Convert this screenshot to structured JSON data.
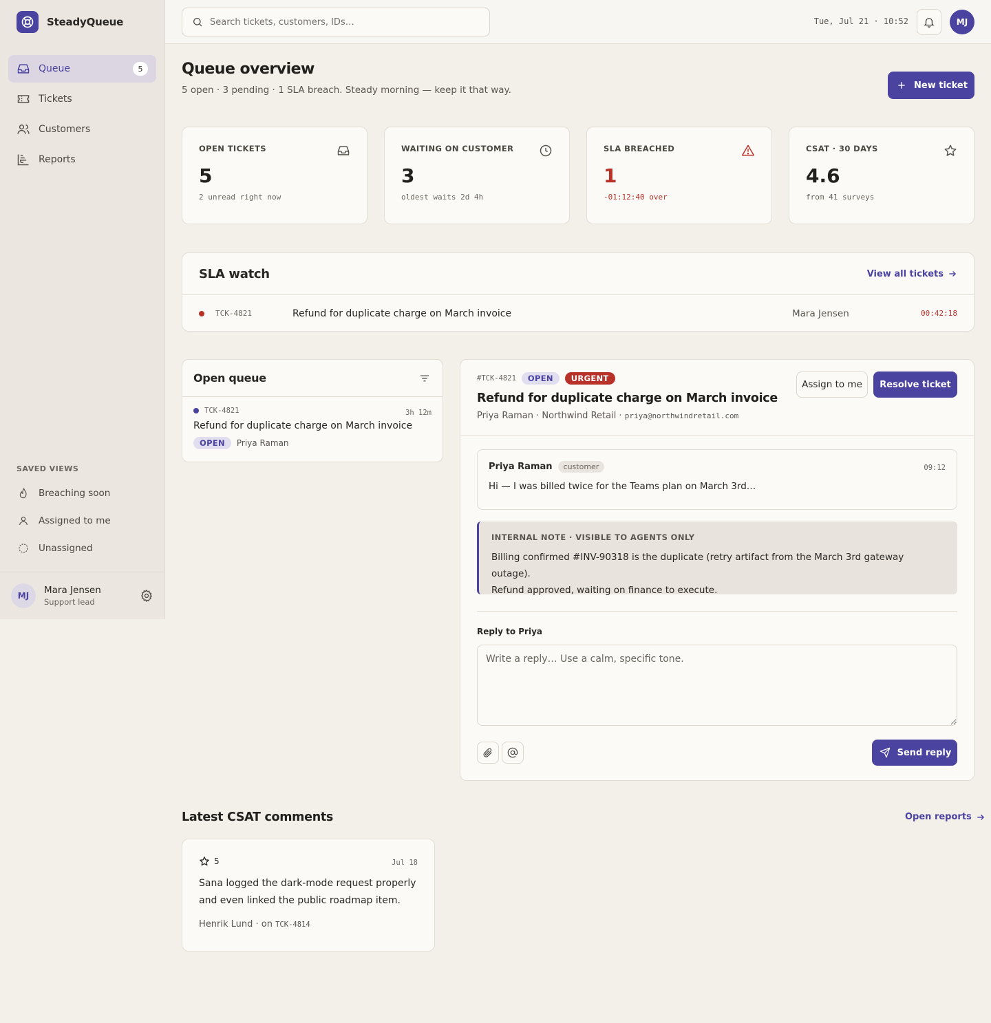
{
  "brand": {
    "name": "SteadyQueue"
  },
  "nav": [
    {
      "label": "Queue",
      "badge": "5",
      "icon": "inbox-icon"
    },
    {
      "label": "Tickets",
      "icon": "ticket-icon"
    },
    {
      "label": "Customers",
      "icon": "users-icon"
    },
    {
      "label": "Reports",
      "icon": "bar-chart-icon"
    }
  ],
  "saved_views": {
    "title": "SAVED VIEWS",
    "items": [
      {
        "label": "Breaching soon",
        "icon": "flame-icon"
      },
      {
        "label": "Assigned to me",
        "icon": "user-icon"
      },
      {
        "label": "Unassigned",
        "icon": "dashed-circle-icon"
      }
    ]
  },
  "user": {
    "initials": "MJ",
    "name": "Mara Jensen",
    "role": "Support lead"
  },
  "topbar": {
    "search_placeholder": "Search tickets, customers, IDs…",
    "datetime": "Tue, Jul 21 · 10:52",
    "avatar": "MJ"
  },
  "header": {
    "title": "Queue overview",
    "subtitle": "5 open · 3 pending · 1 SLA breach. Steady morning — keep it that way.",
    "new_ticket": "New ticket"
  },
  "stats": [
    {
      "label": "OPEN TICKETS",
      "value": "5",
      "note": "2 unread right now",
      "icon": "inbox-icon"
    },
    {
      "label": "WAITING ON CUSTOMER",
      "value": "3",
      "note": "oldest waits 2d 4h",
      "icon": "clock-icon"
    },
    {
      "label": "SLA BREACHED",
      "value": "1",
      "note": "-01:12:40 over",
      "icon": "alert-triangle-icon"
    },
    {
      "label": "CSAT · 30 DAYS",
      "value": "4.6",
      "note": "from 41 surveys",
      "icon": "star-icon"
    }
  ],
  "sla_watch": {
    "title": "SLA watch",
    "link": "View all tickets",
    "rows": [
      {
        "id": "TCK-4821",
        "subject": "Refund for duplicate charge on March invoice",
        "agent": "Mara Jensen",
        "timer": "00:42:18"
      }
    ]
  },
  "open_queue": {
    "title": "Open queue",
    "items": [
      {
        "id": "TCK-4821",
        "age": "3h 12m",
        "subject": "Refund for duplicate charge on March invoice",
        "status": "OPEN",
        "customer": "Priya Raman"
      }
    ]
  },
  "ticket": {
    "id": "#TCK-4821",
    "status": "OPEN",
    "priority": "URGENT",
    "title": "Refund for duplicate charge on March invoice",
    "customer_line": "Priya Raman · Northwind Retail · ",
    "email": "priya@northwindretail.com",
    "assign_label": "Assign to me",
    "resolve_label": "Resolve ticket",
    "message": {
      "from": "Priya Raman",
      "role": "customer",
      "time": "09:12",
      "body": "Hi — I was billed twice for the Teams plan on March 3rd…"
    },
    "note": {
      "label": "INTERNAL NOTE · VISIBLE TO AGENTS ONLY",
      "body_line1": "Billing confirmed #INV-90318 is the duplicate (retry artifact from the March 3rd gateway outage).",
      "body_line2": "Refund approved, waiting on finance to execute."
    },
    "reply_label": "Reply to Priya",
    "reply_placeholder": "Write a reply… Use a calm, specific tone.",
    "send_label": "Send reply"
  },
  "csat": {
    "title": "Latest CSAT comments",
    "link": "Open reports",
    "comments": [
      {
        "rating": "5",
        "date": "Jul 18",
        "body_line1": "Sana logged the dark-mode request properly",
        "body_line2": "and even linked the public roadmap item.",
        "author": "Henrik Lund · on ",
        "ticket": "TCK-4814"
      }
    ]
  },
  "colors": {
    "accent": "#4b43a0",
    "danger": "#b8322a",
    "background": "#f3f0ea",
    "surface": "#fbfaf7"
  }
}
